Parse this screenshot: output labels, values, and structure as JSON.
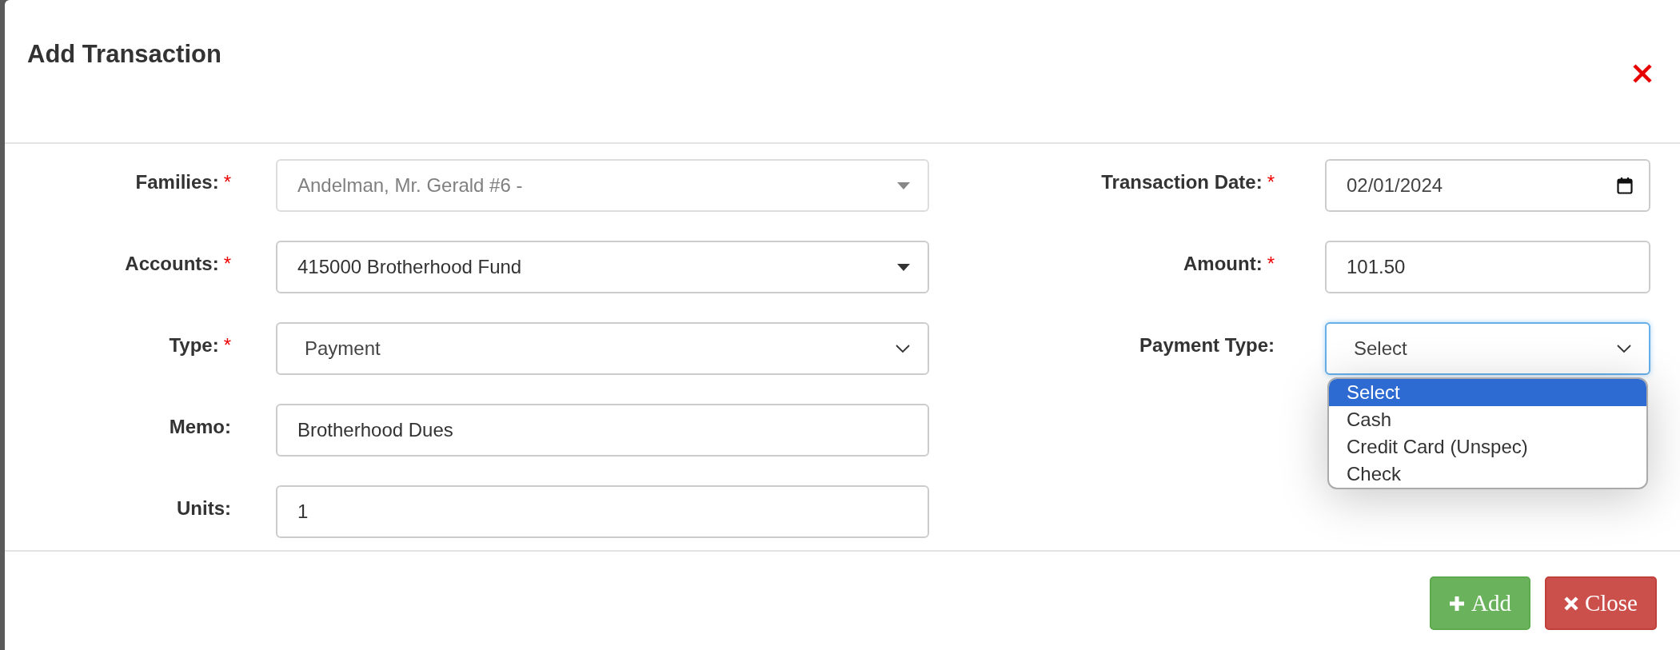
{
  "dialog": {
    "title": "Add Transaction"
  },
  "required_marker": "*",
  "fields_left": [
    {
      "label": "Families:",
      "required": true,
      "kind": "combo",
      "value": "Andelman, Mr. Gerald #6 -",
      "disabled": true
    },
    {
      "label": "Accounts:",
      "required": true,
      "kind": "combo",
      "value": "415000 Brotherhood Fund",
      "disabled": false
    },
    {
      "label": "Type:",
      "required": true,
      "kind": "select",
      "value": "Payment",
      "disabled": false
    },
    {
      "label": "Memo:",
      "required": false,
      "kind": "text",
      "value": "Brotherhood Dues",
      "disabled": false
    },
    {
      "label": "Units:",
      "required": false,
      "kind": "text",
      "value": "1",
      "disabled": false
    }
  ],
  "fields_right": [
    {
      "label": "Transaction Date:",
      "required": true,
      "kind": "date",
      "value": "02/01/2024",
      "focused": false
    },
    {
      "label": "Amount:",
      "required": true,
      "kind": "text",
      "value": "101.50",
      "focused": false
    },
    {
      "label": "Payment Type:",
      "required": false,
      "kind": "select",
      "value": "Select",
      "focused": true,
      "options": [
        {
          "label": "Select",
          "selected": true
        },
        {
          "label": "Cash",
          "selected": false
        },
        {
          "label": "Credit Card (Unspec)",
          "selected": false
        },
        {
          "label": "Check",
          "selected": false
        }
      ]
    }
  ],
  "buttons": [
    {
      "label": "Add",
      "kind": "add"
    },
    {
      "label": "Close",
      "kind": "close"
    }
  ]
}
